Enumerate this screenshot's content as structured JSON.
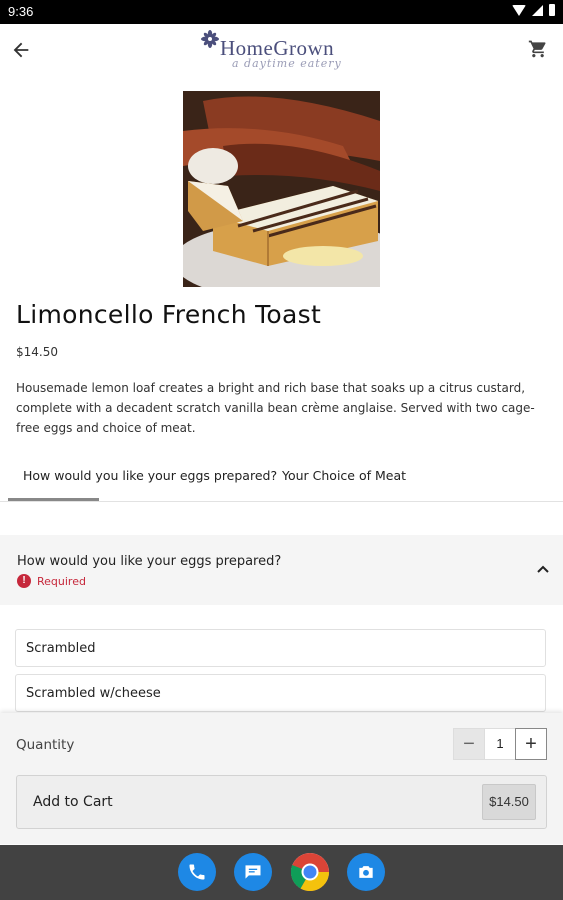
{
  "status_bar": {
    "time": "9:36"
  },
  "header": {
    "logo_name": "HomeGrown",
    "logo_tagline": "a daytime eatery"
  },
  "item": {
    "title": "Limoncello French Toast",
    "price": "$14.50",
    "description": "Housemade lemon loaf creates a bright and rich base that soaks up a citrus custard, complete with a decadent scratch vanilla bean crème anglaise. Served with two cage-free eggs and choice of meat."
  },
  "tabs": [
    {
      "label": "How would you like your eggs prepared?",
      "active": true
    },
    {
      "label": "Your Choice of Meat",
      "active": false
    }
  ],
  "modifier_group": {
    "title": "How would you like your eggs prepared?",
    "required_label": "Required",
    "required_color": "#c6283b",
    "options": [
      {
        "label": "Scrambled"
      },
      {
        "label": "Scrambled w/cheese"
      }
    ]
  },
  "order": {
    "quantity_label": "Quantity",
    "quantity": "1",
    "minus_symbol": "−",
    "plus_symbol": "+",
    "add_to_cart_label": "Add to Cart",
    "add_to_cart_price": "$14.50"
  },
  "dock": {
    "apps": [
      "phone-icon",
      "messages-icon",
      "chrome-icon",
      "camera-icon"
    ]
  }
}
